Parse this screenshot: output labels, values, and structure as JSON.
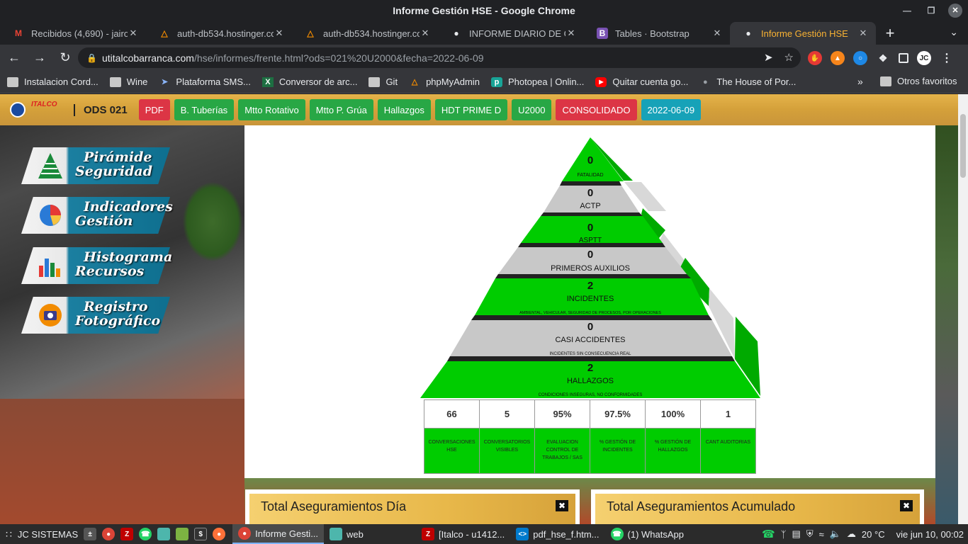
{
  "window": {
    "title": "Informe Gestión HSE - Google Chrome"
  },
  "tabs": [
    {
      "label": "Recibidos (4,690) - jairo",
      "icon": "gmail-icon"
    },
    {
      "label": "auth-db534.hostinger.co",
      "icon": "hostinger-icon"
    },
    {
      "label": "auth-db534.hostinger.co",
      "icon": "hostinger-icon"
    },
    {
      "label": "INFORME DIARIO DE GE",
      "icon": "globe-icon"
    },
    {
      "label": "Tables · Bootstrap",
      "icon": "bootstrap-icon"
    },
    {
      "label": "Informe Gestión HSE",
      "icon": "globe-icon",
      "active": true
    }
  ],
  "address": {
    "host": "utitalcobarranca.com",
    "path": "/hse/informes/frente.html?ods=021%20U2000&fecha=2022-06-09"
  },
  "bookmarks": [
    {
      "label": "Instalacion Cord...",
      "icon": "folder-icon"
    },
    {
      "label": "Wine",
      "icon": "folder-icon"
    },
    {
      "label": "Plataforma SMS...",
      "icon": "send-icon"
    },
    {
      "label": "Conversor de arc...",
      "icon": "excel-icon"
    },
    {
      "label": "Git",
      "icon": "folder-icon"
    },
    {
      "label": "phpMyAdmin",
      "icon": "phpmyadmin-icon"
    },
    {
      "label": "Photopea | Onlin...",
      "icon": "photopea-icon"
    },
    {
      "label": "Quitar cuenta go...",
      "icon": "youtube-icon"
    },
    {
      "label": "The House of Por...",
      "icon": "globe-icon"
    }
  ],
  "bookmarks_other": "Otros favoritos",
  "header": {
    "logo_text": "ITALCO",
    "ods": "ODS 021",
    "buttons": [
      {
        "label": "PDF",
        "color": "red"
      },
      {
        "label": "B. Tuberías",
        "color": "green"
      },
      {
        "label": "Mtto Rotativo",
        "color": "green"
      },
      {
        "label": "Mtto P. Grúa",
        "color": "green"
      },
      {
        "label": "Hallazgos",
        "color": "green"
      },
      {
        "label": "HDT PRIME D",
        "color": "green"
      },
      {
        "label": "U2000",
        "color": "green"
      },
      {
        "label": "CONSOLIDADO",
        "color": "red"
      },
      {
        "label": "2022-06-09",
        "color": "blue"
      }
    ]
  },
  "menu": [
    {
      "line1": "Pirámide",
      "line2": "Seguridad",
      "icon": "pyramid-icon"
    },
    {
      "line1": "Indicadores",
      "line2": "Gestión",
      "icon": "pie-chart-icon"
    },
    {
      "line1": "Histograma",
      "line2": "Recursos",
      "icon": "bar-chart-icon"
    },
    {
      "line1": "Registro",
      "line2": "Fotográfico",
      "icon": "camera-icon"
    }
  ],
  "pyramid": [
    {
      "value": "0",
      "label": "FATALIDAD",
      "sub": "",
      "color": "#00cc00"
    },
    {
      "value": "0",
      "label": "ACTP",
      "sub": "",
      "color": "#c8c8c8"
    },
    {
      "value": "0",
      "label": "ASPTT",
      "sub": "",
      "color": "#00cc00"
    },
    {
      "value": "0",
      "label": "PRIMEROS AUXILIOS",
      "sub": "",
      "color": "#c8c8c8"
    },
    {
      "value": "2",
      "label": "INCIDENTES",
      "sub": "AMBIENTAL, VEHICULAR, SEGURIDAD DE PROCESOS, POR OPERACIONES",
      "color": "#00cc00"
    },
    {
      "value": "0",
      "label": "CASI ACCIDENTES",
      "sub": "INCIDENTES SIN CONSECUENCIA REAL",
      "color": "#c8c8c8"
    },
    {
      "value": "2",
      "label": "HALLAZGOS",
      "sub": "CONDICIONES INSEGURAS, NO CONFORMIDADES",
      "color": "#00cc00"
    }
  ],
  "stats": [
    {
      "value": "66",
      "label": "CONVERSACIONES HSE"
    },
    {
      "value": "5",
      "label": "CONVERSATORIOS VISIBLES"
    },
    {
      "value": "95%",
      "label": "EVALUACION CONTROL DE TRABAJOS / SAS"
    },
    {
      "value": "97.5%",
      "label": "% GESTIÓN DE INCIDENTES"
    },
    {
      "value": "100%",
      "label": "% GESTIÓN DE HALLAZGOS"
    },
    {
      "value": "1",
      "label": "CANT AUDITORIAS"
    }
  ],
  "cards": [
    {
      "title": "Total Aseguramientos Día"
    },
    {
      "title": "Total Aseguramientos Acumulado"
    }
  ],
  "taskbar": {
    "menu_label": "JC SISTEMAS",
    "tasks": [
      {
        "label": "Informe Gesti...",
        "icon": "chrome-icon",
        "active": true
      },
      {
        "label": "web",
        "icon": "folder-icon"
      },
      {
        "label": "[Italco - u1412...",
        "icon": "filezilla-icon"
      },
      {
        "label": "pdf_hse_f.htm...",
        "icon": "vscode-icon"
      },
      {
        "label": "(1) WhatsApp",
        "icon": "whatsapp-icon"
      }
    ],
    "temperature": "20 °C",
    "clock": "vie jun 10, 00:02"
  }
}
